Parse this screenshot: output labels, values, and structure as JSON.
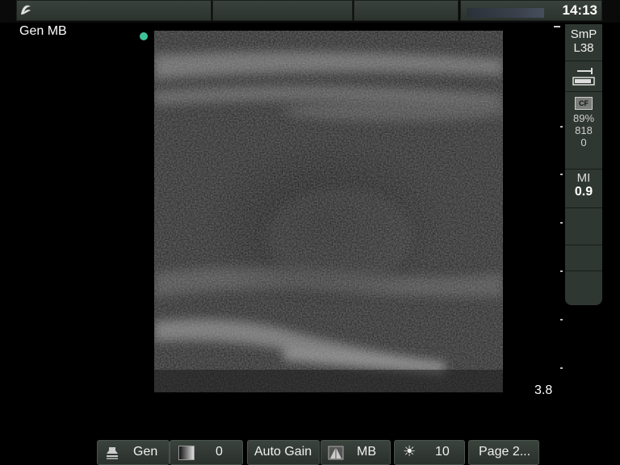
{
  "header": {
    "time": "14:13",
    "logo_icon": "wave-logo-icon"
  },
  "mode_label": "Gen MB",
  "depth": {
    "value": "3.8"
  },
  "right_panel": {
    "probe_line1": "SmP",
    "probe_line2": "L38",
    "cf_icon_text": "CF",
    "power_percent": "89%",
    "value_a": "818",
    "value_b": "0",
    "mi_label": "MI",
    "mi_value": "0.9"
  },
  "bottom_bar": {
    "exam_label": "Gen",
    "gain_value": "0",
    "auto_gain_label": "Auto Gain",
    "mode_label": "MB",
    "brightness_value": "10",
    "page_label": "Page 2..."
  },
  "colors": {
    "panel": "#2f3732",
    "indicator_dot": "#3fc29a"
  }
}
